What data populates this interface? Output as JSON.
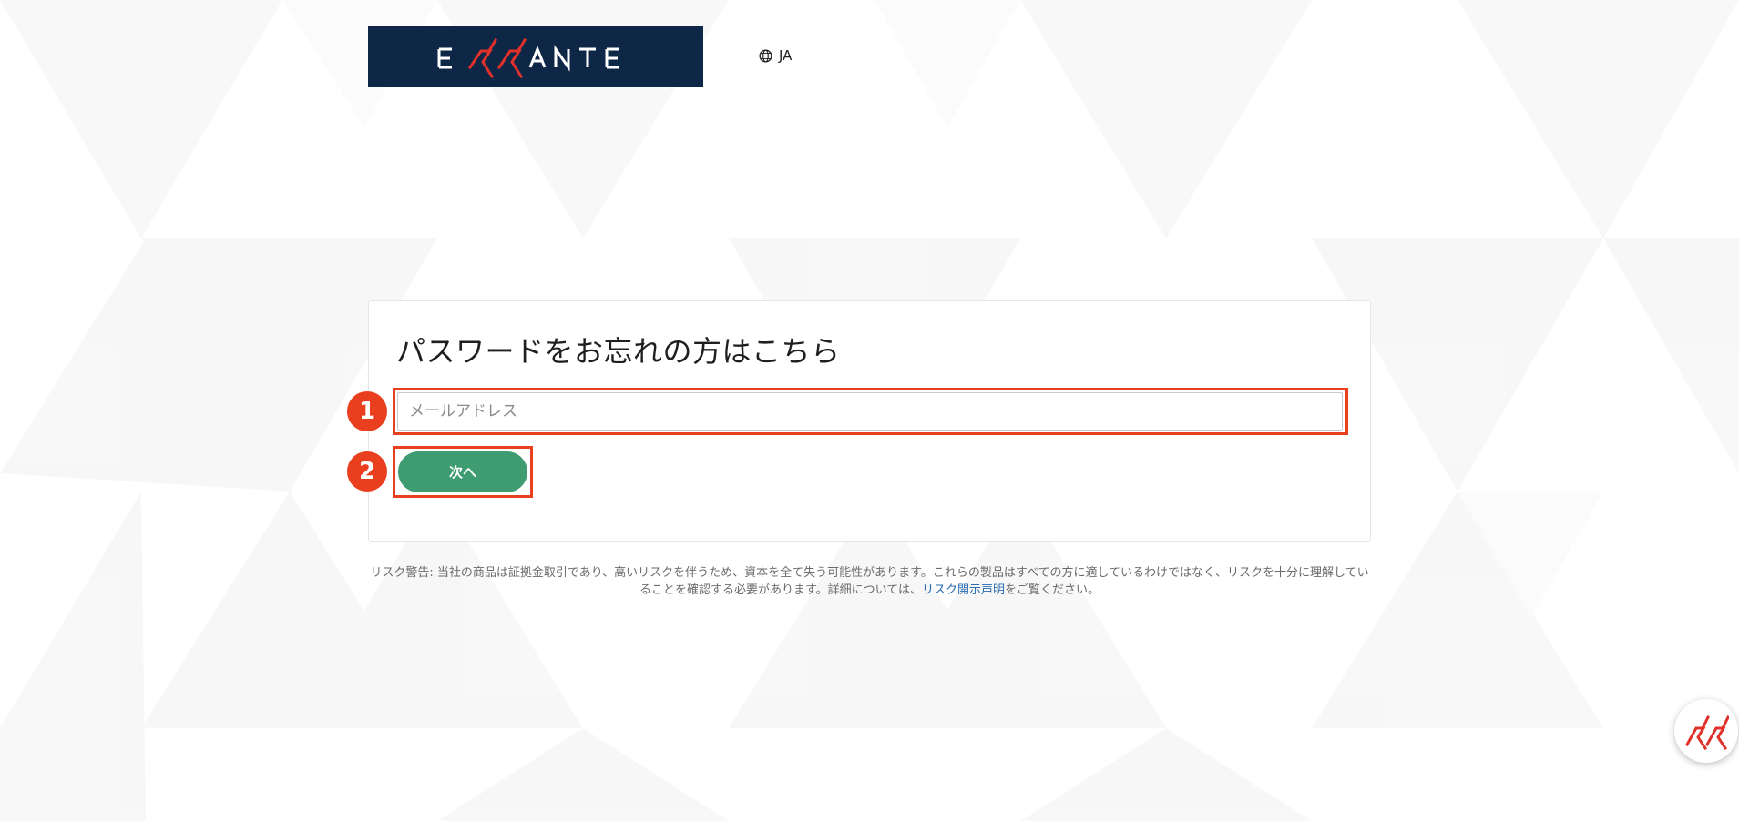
{
  "header": {
    "logo_text": "ERRANTE",
    "language_label": "JA"
  },
  "form": {
    "title": "パスワードをお忘れの方はこちら",
    "email_placeholder": "メールアドレス",
    "next_label": "次へ"
  },
  "annotations": {
    "step1": "1",
    "step2": "2"
  },
  "risk_warning": {
    "prefix": "リスク警告: 当社の商品は証拠金取引であり、高いリスクを伴うため、資本を全て失う可能性があります。これらの製品はすべての方に適しているわけではなく、リスクを十分に理解していることを確認する必要があります。詳細については、",
    "link_text": "リスク開示声明",
    "suffix": "をご覧ください。"
  },
  "colors": {
    "brand_navy": "#0e2746",
    "brand_red": "#e0312b",
    "primary_button": "#3e9c70",
    "annotation_red": "#e8401f",
    "link": "#2a6db0"
  },
  "icons": {
    "language": "globe-icon",
    "chat": "errante-chat-icon"
  }
}
